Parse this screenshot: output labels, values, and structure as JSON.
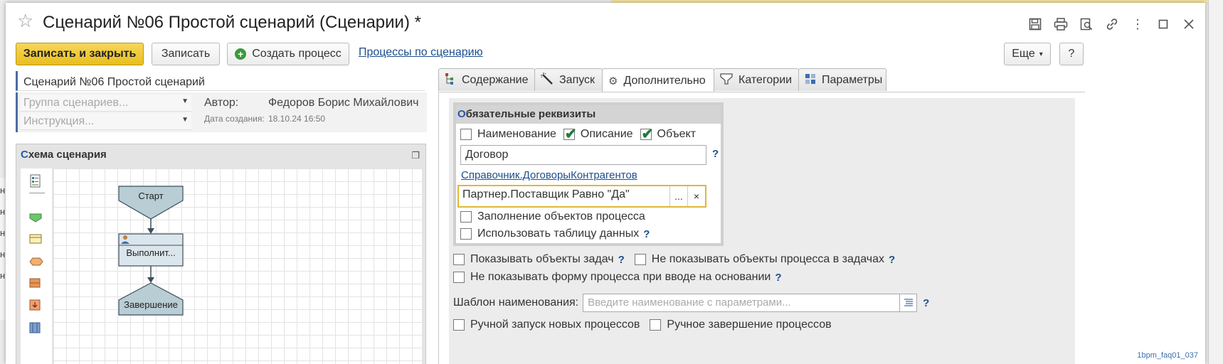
{
  "window": {
    "title": "Сценарий №06 Простой сценарий (Сценарии) *"
  },
  "background": {
    "left_fragments": [
      "н",
      "н",
      "н",
      "н",
      "н"
    ]
  },
  "toolbar": {
    "save_close": "Записать и закрыть",
    "save": "Записать",
    "create_process": "Создать процесс",
    "processes_link": "Процессы по сценарию",
    "more": "Еще",
    "more_arrow": "▾",
    "help": "?"
  },
  "header": {
    "name_value": "Сценарий №06 Простой сценарий",
    "group_placeholder": "Группа сценариев...",
    "instruction_placeholder": "Инструкция...",
    "author_label": "Автор:",
    "author_value": "Федоров Борис Михайлович",
    "date_label": "Дата создания:",
    "date_value": "18.10.24 16:50"
  },
  "schema": {
    "title_first": "С",
    "title_rest": "хема сценария",
    "nodes": {
      "start": "Старт",
      "task": "Выполнит...",
      "end": "Завершение"
    }
  },
  "tabs": [
    {
      "label": "Содержание",
      "icon": "content-tree-icon"
    },
    {
      "label": "Запуск",
      "icon": "wand-icon"
    },
    {
      "label": "Дополнительно",
      "icon": "gear-icon"
    },
    {
      "label": "Категории",
      "icon": "category-icon"
    },
    {
      "label": "Параметры",
      "icon": "parameters-icon"
    }
  ],
  "required": {
    "title_first": "О",
    "title_rest": "бязательные реквизиты",
    "cb_name": "Наименование",
    "cb_name_checked": false,
    "cb_description": "Описание",
    "cb_description_checked": true,
    "cb_object": "Объект",
    "cb_object_checked": true,
    "object_type_value": "Договор",
    "object_link": "Справочник.ДоговорыКонтрагентов",
    "filter_value": "Партнер.Поставщик Равно \"Да\"",
    "filter_choose": "...",
    "filter_clear": "×",
    "fill_objects": "Заполнение объектов процесса",
    "use_data_table": "Использовать таблицу данных"
  },
  "options": {
    "show_task_objects": "Показывать объекты задач",
    "hide_process_objects": "Не показывать объекты процесса в задачах",
    "hide_process_form": "Не показывать форму процесса при вводе на основании",
    "name_template_label": "Шаблон наименования:",
    "name_template_placeholder": "Введите наименование с параметрами...",
    "manual_start": "Ручной запуск новых процессов",
    "manual_finish": "Ручное завершение процессов",
    "q": "?"
  },
  "footer_tag": "1bpm_faq01_037"
}
